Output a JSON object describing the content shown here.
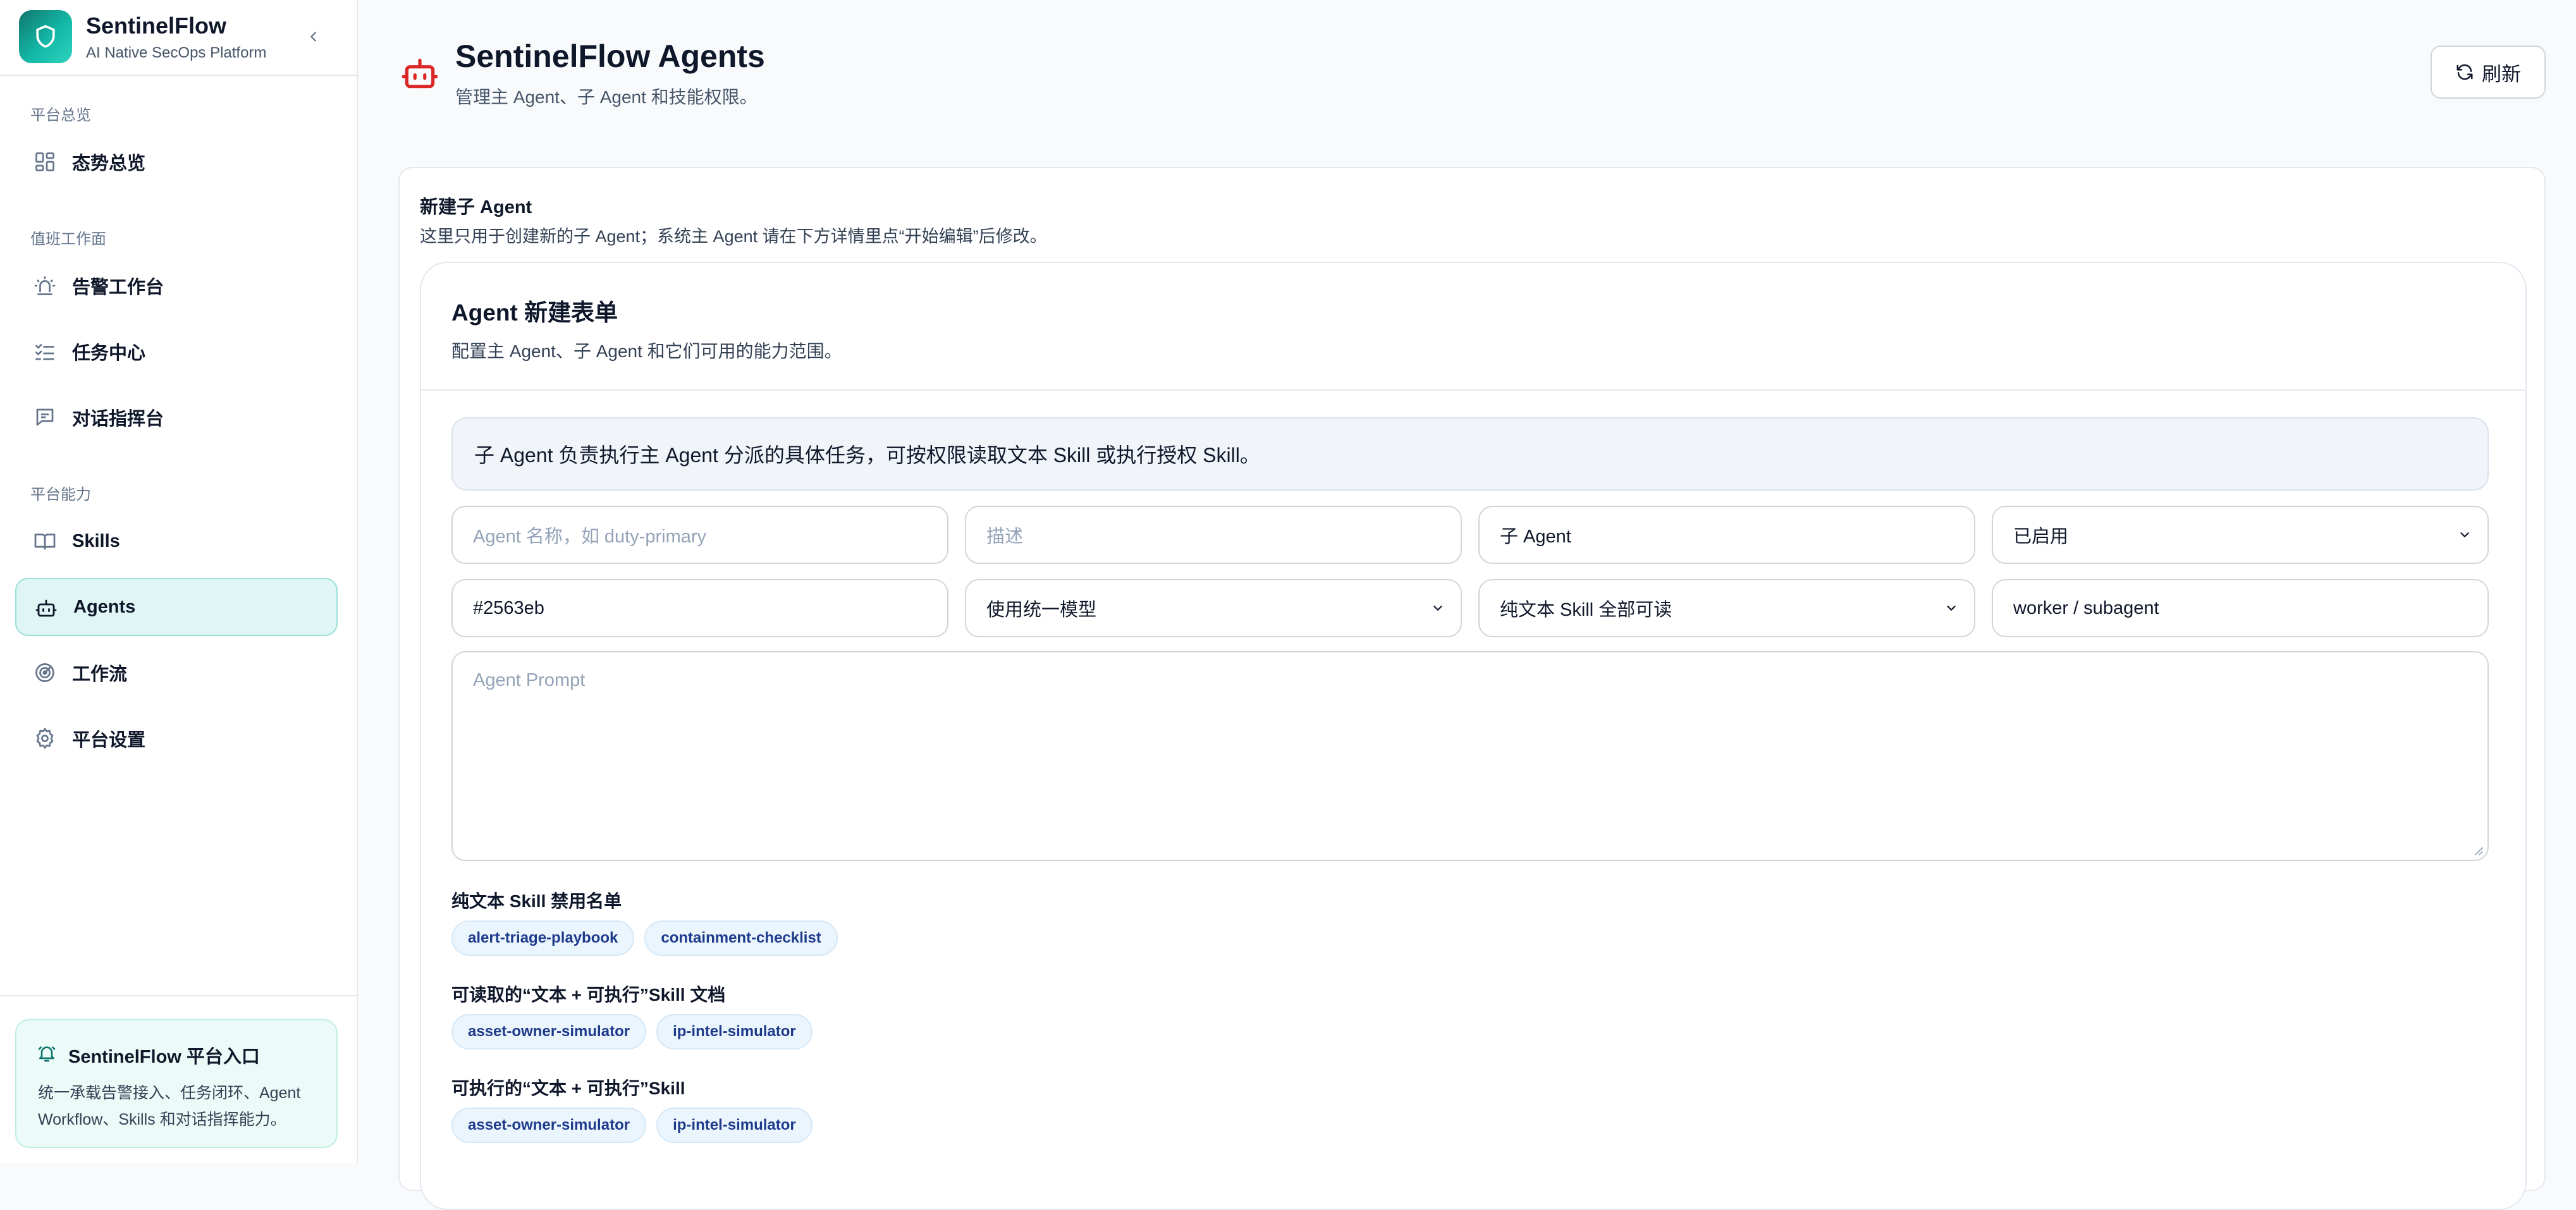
{
  "brand": {
    "name": "SentinelFlow",
    "subtitle": "AI Native SecOps Platform"
  },
  "sidebar": {
    "sections": [
      {
        "title": "平台总览"
      },
      {
        "title": "值班工作面"
      },
      {
        "title": "平台能力"
      }
    ],
    "items": [
      {
        "label": "态势总览",
        "icon": "grid-icon"
      },
      {
        "label": "告警工作台",
        "icon": "siren-icon"
      },
      {
        "label": "任务中心",
        "icon": "list-checks-icon"
      },
      {
        "label": "对话指挥台",
        "icon": "message-square-icon"
      },
      {
        "label": "Skills",
        "icon": "book-open-icon"
      },
      {
        "label": "Agents",
        "icon": "bot-icon",
        "active": true
      },
      {
        "label": "工作流",
        "icon": "radar-icon"
      },
      {
        "label": "平台设置",
        "icon": "gear-icon"
      }
    ],
    "footer": {
      "title": "SentinelFlow 平台入口",
      "text": "统一承载告警接入、任务闭环、Agent Workflow、Skills 和对话指挥能力。"
    }
  },
  "header": {
    "title": "SentinelFlow Agents",
    "subtitle": "管理主 Agent、子 Agent 和技能权限。",
    "refresh_label": "刷新"
  },
  "create_section": {
    "title": "新建子 Agent",
    "description": "这里只用于创建新的子 Agent；系统主 Agent 请在下方详情里点“开始编辑”后修改。"
  },
  "form": {
    "title": "Agent 新建表单",
    "description": "配置主 Agent、子 Agent 和它们可用的能力范围。",
    "info": "子 Agent 负责执行主 Agent 分派的具体任务，可按权限读取文本 Skill 或执行授权 Skill。",
    "name_placeholder": "Agent 名称，如 duty-primary",
    "desc_placeholder": "描述",
    "role_value": "子 Agent",
    "status_value": "已启用",
    "color_value": "#2563eb",
    "model_value": "使用统一模型",
    "skill_read_value": "纯文本 Skill 全部可读",
    "tags_value": "worker / subagent",
    "prompt_placeholder": "Agent Prompt",
    "blocked_label": "纯文本 Skill 禁用名单",
    "blocked_chips": [
      "alert-triage-playbook",
      "containment-checklist"
    ],
    "readable_label": "可读取的“文本 + 可执行”Skill 文档",
    "readable_chips": [
      "asset-owner-simulator",
      "ip-intel-simulator"
    ],
    "executable_label": "可执行的“文本 + 可执行”Skill",
    "executable_chips": [
      "asset-owner-simulator",
      "ip-intel-simulator"
    ]
  },
  "colors": {
    "accent": "#0f766e",
    "active_bg": "#e0f6f4",
    "danger_icon": "#dc2626",
    "chip_bg": "#ebf5fd",
    "chip_text": "#1e3a8a"
  }
}
